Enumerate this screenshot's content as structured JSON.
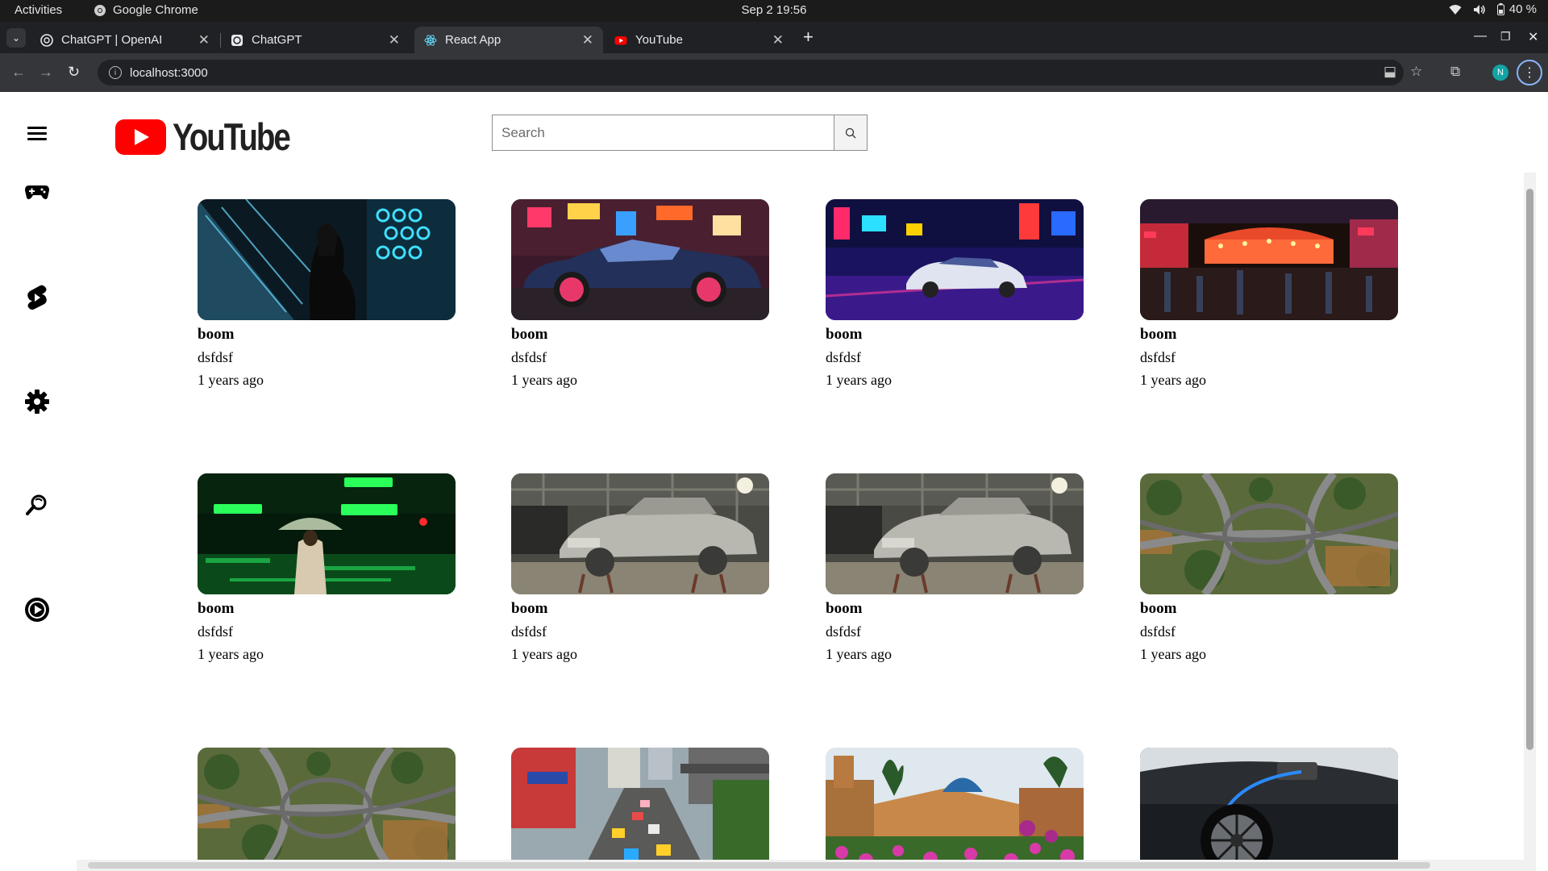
{
  "os_bar": {
    "activities": "Activities",
    "app_name": "Google Chrome",
    "clock": "Sep 2  19:56",
    "battery": "40 %"
  },
  "browser": {
    "tabs": [
      {
        "label": "ChatGPT | OpenAI",
        "icon": "openai-icon"
      },
      {
        "label": "ChatGPT",
        "icon": "openai-icon"
      },
      {
        "label": "React App",
        "icon": "react-icon"
      },
      {
        "label": "YouTube",
        "icon": "youtube-icon"
      }
    ],
    "url": "localhost:3000"
  },
  "header": {
    "logo_text": "YouTube",
    "search_placeholder": "Search"
  },
  "sidebar": {
    "items": [
      {
        "icon": "hamburger-menu-icon"
      },
      {
        "icon": "gamepad-icon"
      },
      {
        "icon": "shorts-icon"
      },
      {
        "icon": "settings-gear-icon"
      },
      {
        "icon": "search-refresh-icon"
      },
      {
        "icon": "play-circle-icon"
      }
    ]
  },
  "videos": [
    {
      "title": "boom",
      "channel": "dsfdsf",
      "date": "1 years ago",
      "thumb": "neon-woman-phone"
    },
    {
      "title": "boom",
      "channel": "dsfdsf",
      "date": "1 years ago",
      "thumb": "blue-car-neon-street"
    },
    {
      "title": "boom",
      "channel": "dsfdsf",
      "date": "1 years ago",
      "thumb": "white-car-neon-night"
    },
    {
      "title": "boom",
      "channel": "dsfdsf",
      "date": "1 years ago",
      "thumb": "night-market-street"
    },
    {
      "title": "boom",
      "channel": "dsfdsf",
      "date": "1 years ago",
      "thumb": "green-neon-umbrella"
    },
    {
      "title": "boom",
      "channel": "dsfdsf",
      "date": "1 years ago",
      "thumb": "vintage-car-garage"
    },
    {
      "title": "boom",
      "channel": "dsfdsf",
      "date": "1 years ago",
      "thumb": "vintage-car-garage"
    },
    {
      "title": "boom",
      "channel": "dsfdsf",
      "date": "1 years ago",
      "thumb": "highway-interchange-aerial"
    },
    {
      "title": "",
      "channel": "",
      "date": "",
      "thumb": "highway-interchange-aerial"
    },
    {
      "title": "",
      "channel": "",
      "date": "",
      "thumb": "city-traffic-street"
    },
    {
      "title": "",
      "channel": "",
      "date": "",
      "thumb": "mosque-flowers"
    },
    {
      "title": "",
      "channel": "",
      "date": "",
      "thumb": "ev-charging-car"
    }
  ],
  "colors": {
    "youtube_red": "#ff0000",
    "chrome_dark": "#202124",
    "chrome_tab_active": "#35363a"
  }
}
